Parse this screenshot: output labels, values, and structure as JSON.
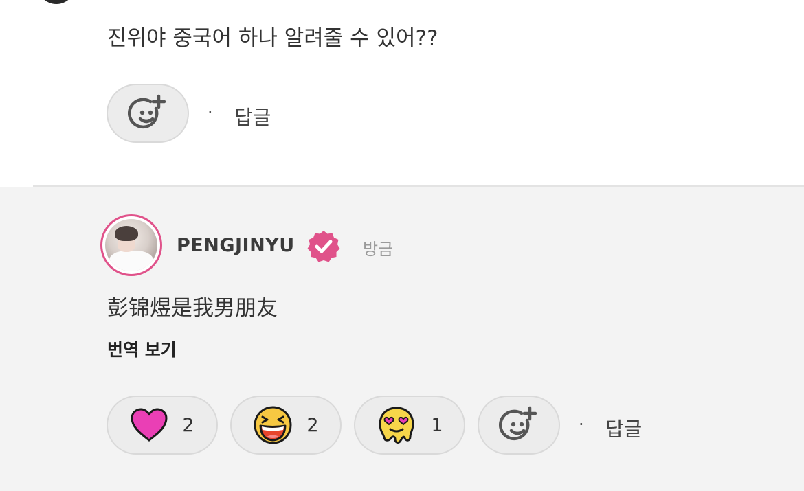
{
  "parent_comment": {
    "text": "진위야 중국어 하나 알려줄 수 있어??",
    "add_reaction_icon": "smiley-plus-icon",
    "separator": "·",
    "reply_label": "답글"
  },
  "reply_comment": {
    "username": "PENGJINYU",
    "verified_icon": "verified-badge-icon",
    "timestamp": "방금",
    "text": "彭锦煜是我男朋友",
    "translate_label": "번역 보기",
    "reactions": [
      {
        "icon": "pink-heart-icon",
        "count": "2"
      },
      {
        "icon": "laughing-face-icon",
        "count": "2"
      },
      {
        "icon": "melting-heart-eyes-icon",
        "count": "1"
      }
    ],
    "add_reaction_icon": "smiley-plus-icon",
    "separator": "·",
    "reply_label": "답글"
  },
  "colors": {
    "accent_pink": "#e0528a",
    "heart_magenta": "#ea3fb5",
    "emoji_yellow": "#f7c842",
    "reply_background": "#f3f3f3"
  }
}
